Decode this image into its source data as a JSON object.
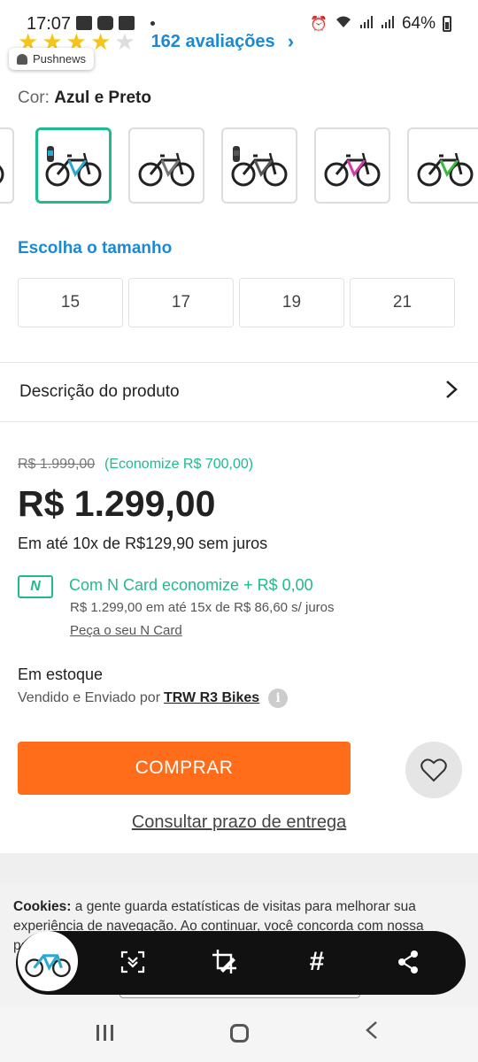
{
  "status_bar": {
    "time": "17:07",
    "battery": "64%"
  },
  "rating": {
    "stars_filled": 4,
    "stars_total": 5,
    "count_text": "162 avaliações"
  },
  "pushnews": {
    "label": "Pushnews"
  },
  "color": {
    "prefix": "Cor:",
    "value": "Azul e Preto"
  },
  "thumbnails": [
    {
      "name": "preto-vermelho",
      "accent": "#c0392b",
      "bottle": false
    },
    {
      "name": "azul-preto",
      "accent": "#2aa9d2",
      "bottle": true,
      "selected": true
    },
    {
      "name": "preto-cinza",
      "accent": "#777777",
      "bottle": false
    },
    {
      "name": "cinza-preto",
      "accent": "#555555",
      "bottle": true
    },
    {
      "name": "preto-rosa",
      "accent": "#d63ca8",
      "bottle": false
    },
    {
      "name": "preto-verde",
      "accent": "#3cb83c",
      "bottle": false
    }
  ],
  "size_section": {
    "title": "Escolha o tamanho",
    "sizes": [
      "15",
      "17",
      "19",
      "21"
    ]
  },
  "description": {
    "label": "Descrição do produto"
  },
  "pricing": {
    "old_price": "R$ 1.999,00",
    "savings": "(Economize R$ 700,00)",
    "price": "R$ 1.299,00",
    "installments": "Em até 10x de R$129,90 sem juros"
  },
  "ncard": {
    "badge": "N",
    "title": "Com N Card economize + R$ 0,00",
    "subtitle": "R$ 1.299,00 em até 15x de R$ 86,60 s/ juros",
    "link": "Peça o seu N Card"
  },
  "stock": {
    "status": "Em estoque",
    "seller_prefix": "Vendido e Enviado por",
    "seller_name": "TRW R3 Bikes",
    "info_glyph": "i"
  },
  "actions": {
    "buy_label": "COMPRAR",
    "delivery_label": "Consultar prazo de entrega"
  },
  "cookie": {
    "bold": "Cookies:",
    "text": " a gente guarda estatísticas de visitas para melhorar sua experiência de navegação. Ao continuar, você concorda com nossa política de privacidade."
  },
  "capture_toolbar": {
    "hash": "#",
    "icons": [
      "scroll-capture-icon",
      "crop-edit-icon",
      "hashtag-icon",
      "share-icon"
    ]
  },
  "colors": {
    "accent_blue": "#1a8ad6",
    "accent_green": "#1fba8e",
    "buy_orange": "#ff6d1a"
  }
}
